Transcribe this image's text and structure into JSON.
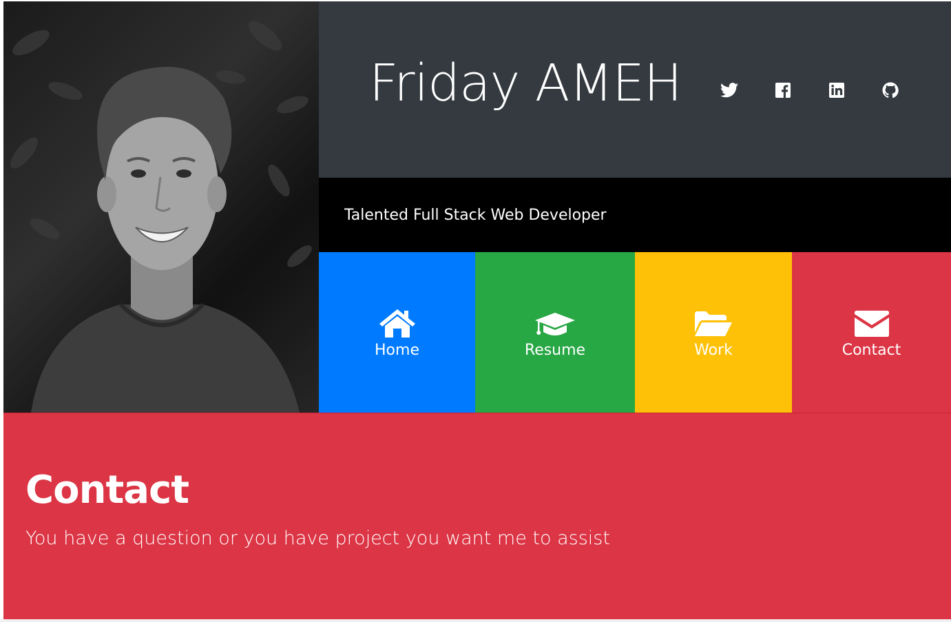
{
  "profile": {
    "name": "Friday AMEH",
    "tagline": "Talented Full Stack Web Developer",
    "photo_alt": "profile-photo"
  },
  "socials": [
    {
      "name": "twitter-icon"
    },
    {
      "name": "facebook-icon"
    },
    {
      "name": "linkedin-icon"
    },
    {
      "name": "github-icon"
    }
  ],
  "nav": {
    "home": {
      "label": "Home",
      "color": "#007bff",
      "icon": "home-icon"
    },
    "resume": {
      "label": "Resume",
      "color": "#28a745",
      "icon": "graduation-cap-icon"
    },
    "work": {
      "label": "Work",
      "color": "#ffc107",
      "icon": "folder-open-icon"
    },
    "contact": {
      "label": "Contact",
      "color": "#dc3545",
      "icon": "envelope-icon"
    }
  },
  "contact_section": {
    "title": "Contact",
    "text": "You have a question or you have project you want me to assist"
  },
  "colors": {
    "header": "#343a40",
    "tagline_bg": "#000000",
    "contact_bg": "#dc3545"
  }
}
